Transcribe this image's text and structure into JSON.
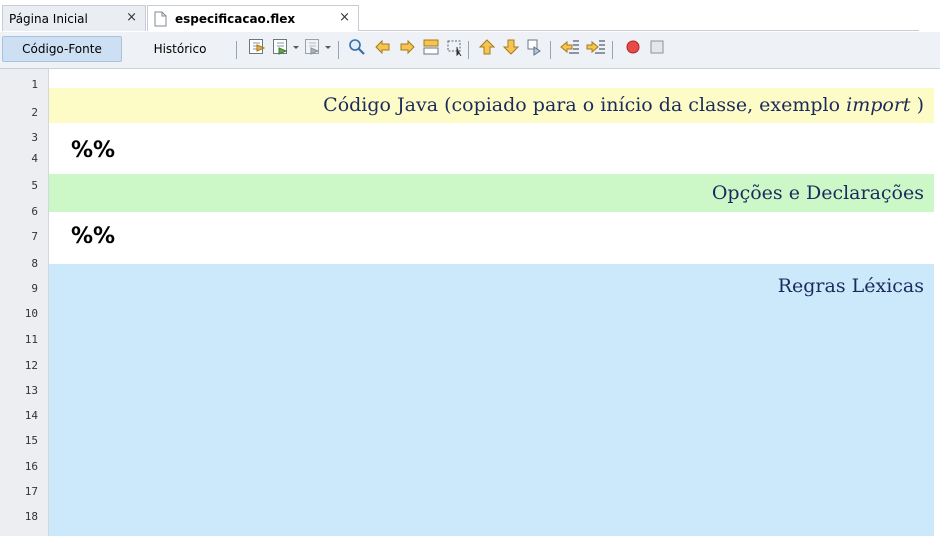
{
  "tabs": [
    {
      "label": "Página Inicial",
      "close": "×"
    },
    {
      "label": "especificacao.flex",
      "close": "×"
    }
  ],
  "toolbar": {
    "source_label": "Código-Fonte",
    "history_label": "Histórico"
  },
  "line_numbers": [
    "1",
    "2",
    "3",
    "4",
    "5",
    "6",
    "7",
    "8",
    "9",
    "10",
    "11",
    "12",
    "13",
    "14",
    "15",
    "16",
    "17",
    "18"
  ],
  "editor": {
    "java_code_prefix": "Código Java (copiado para o início da classe, exemplo ",
    "java_code_emphasis": "import",
    "java_code_suffix": " )",
    "separator_1": "%%",
    "options_label": "Opções e Declarações",
    "separator_2": "%%",
    "rules_label": "Regras Léxicas"
  },
  "colors": {
    "yellow_band": "#fdfcc6",
    "green_band": "#ccf8c8",
    "blue_band": "#cce9fb",
    "label_text": "#1b2a5c"
  },
  "icons": [
    "toggle-bookmark-icon",
    "previous-bookmark-icon",
    "next-bookmark-icon",
    "find-selection-icon",
    "find-previous-icon",
    "find-next-icon",
    "toggle-highlight-icon",
    "rectangular-selection-icon",
    "previous-occurrence-icon",
    "next-occurrence-icon",
    "toggle-search-icon",
    "shift-left-icon",
    "shift-right-icon",
    "start-macro-icon",
    "stop-macro-icon"
  ]
}
